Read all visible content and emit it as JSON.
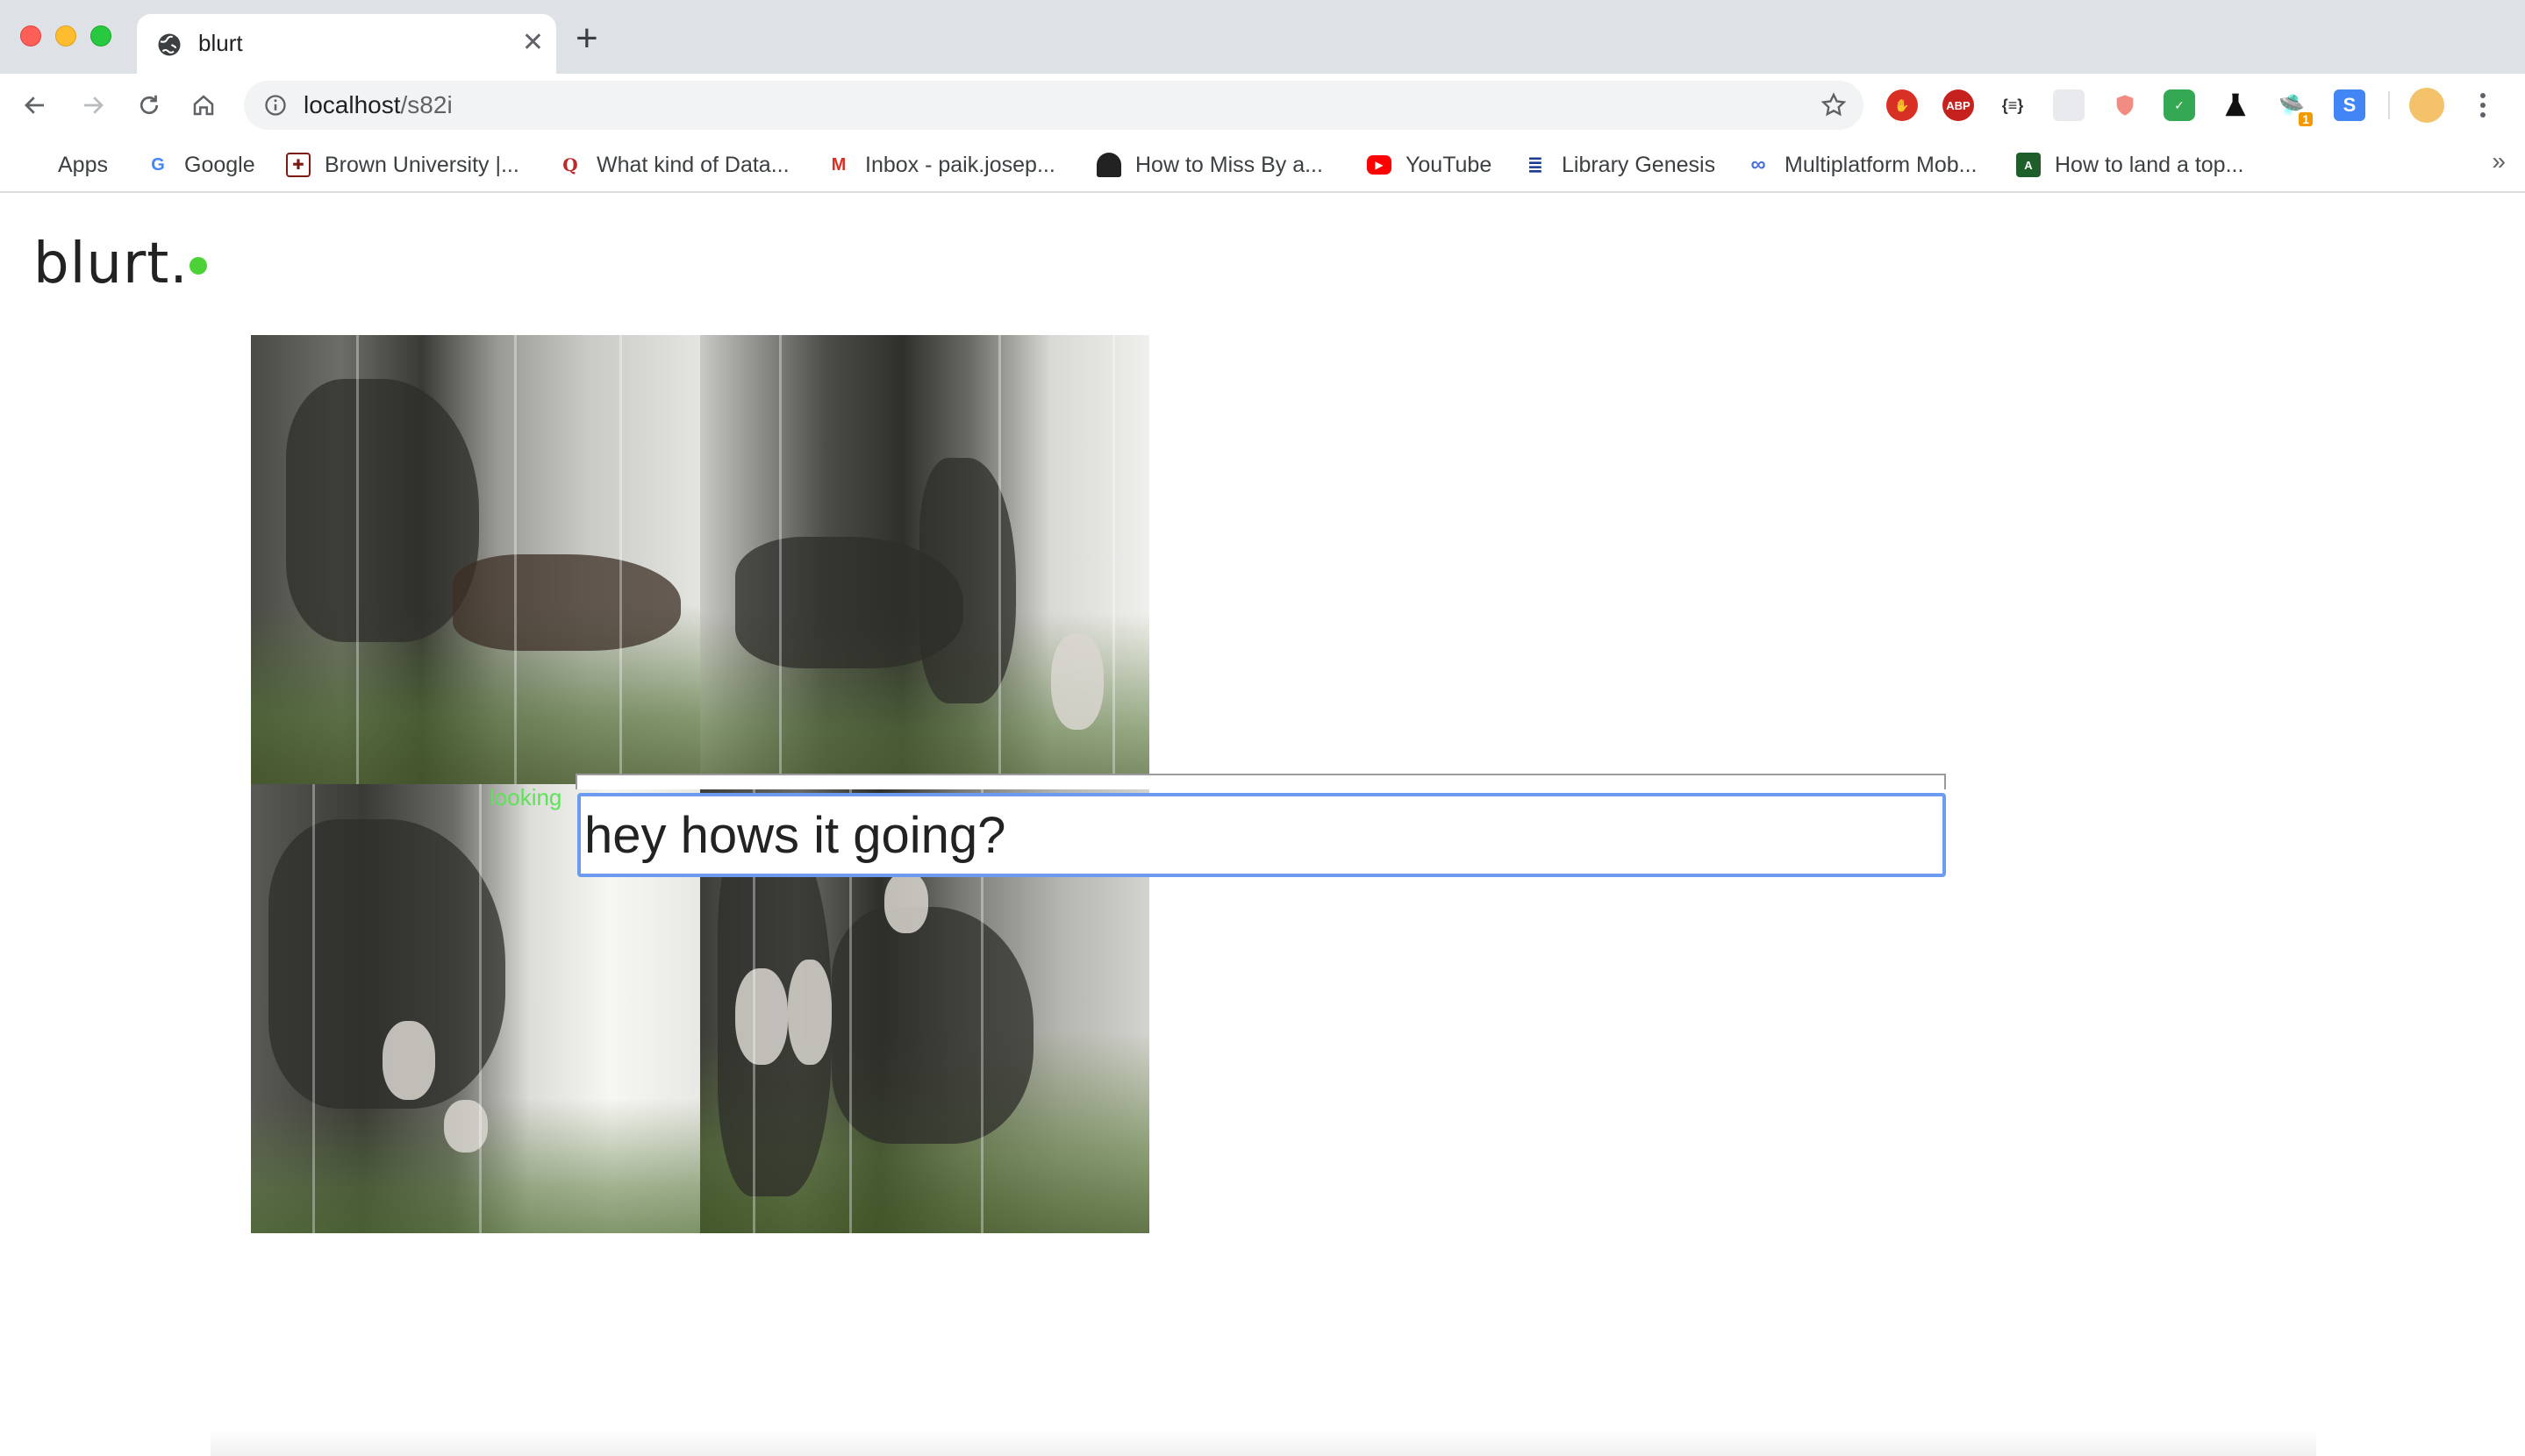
{
  "browser": {
    "tab_title": "blurt",
    "url_host": "localhost",
    "url_path": "/s82i",
    "extension_badge_count": "1",
    "extensions": [
      "adblock-hand-icon",
      "abp-icon",
      "json-viewer-icon",
      "grey-puzzle-icon",
      "shield-icon",
      "green-shield-icon",
      "flask-icon",
      "ufo-icon",
      "s-icon"
    ]
  },
  "bookmarks": [
    {
      "label": "Apps",
      "icon": "apps-grid-icon"
    },
    {
      "label": "Google",
      "icon": "google-icon"
    },
    {
      "label": "Brown University |...",
      "icon": "brown-university-icon"
    },
    {
      "label": "What kind of Data...",
      "icon": "quora-icon"
    },
    {
      "label": "Inbox - paik.josep...",
      "icon": "gmail-icon"
    },
    {
      "label": "How to Miss By a...",
      "icon": "bookmark-site-icon"
    },
    {
      "label": "YouTube",
      "icon": "youtube-icon"
    },
    {
      "label": "Library Genesis",
      "icon": "library-genesis-icon"
    },
    {
      "label": "Multiplatform Mob...",
      "icon": "multiplatform-icon"
    },
    {
      "label": "How to land a top...",
      "icon": "bookmark-site-icon"
    }
  ],
  "bookmarks_overflow": "»",
  "page": {
    "logo": "blurt.",
    "status": "looking",
    "message_value": "hey hows it going?",
    "status_color": "#4cd137"
  },
  "colors": {
    "focus_ring": "#6c9bf0",
    "status_text": "#5ee25a"
  }
}
